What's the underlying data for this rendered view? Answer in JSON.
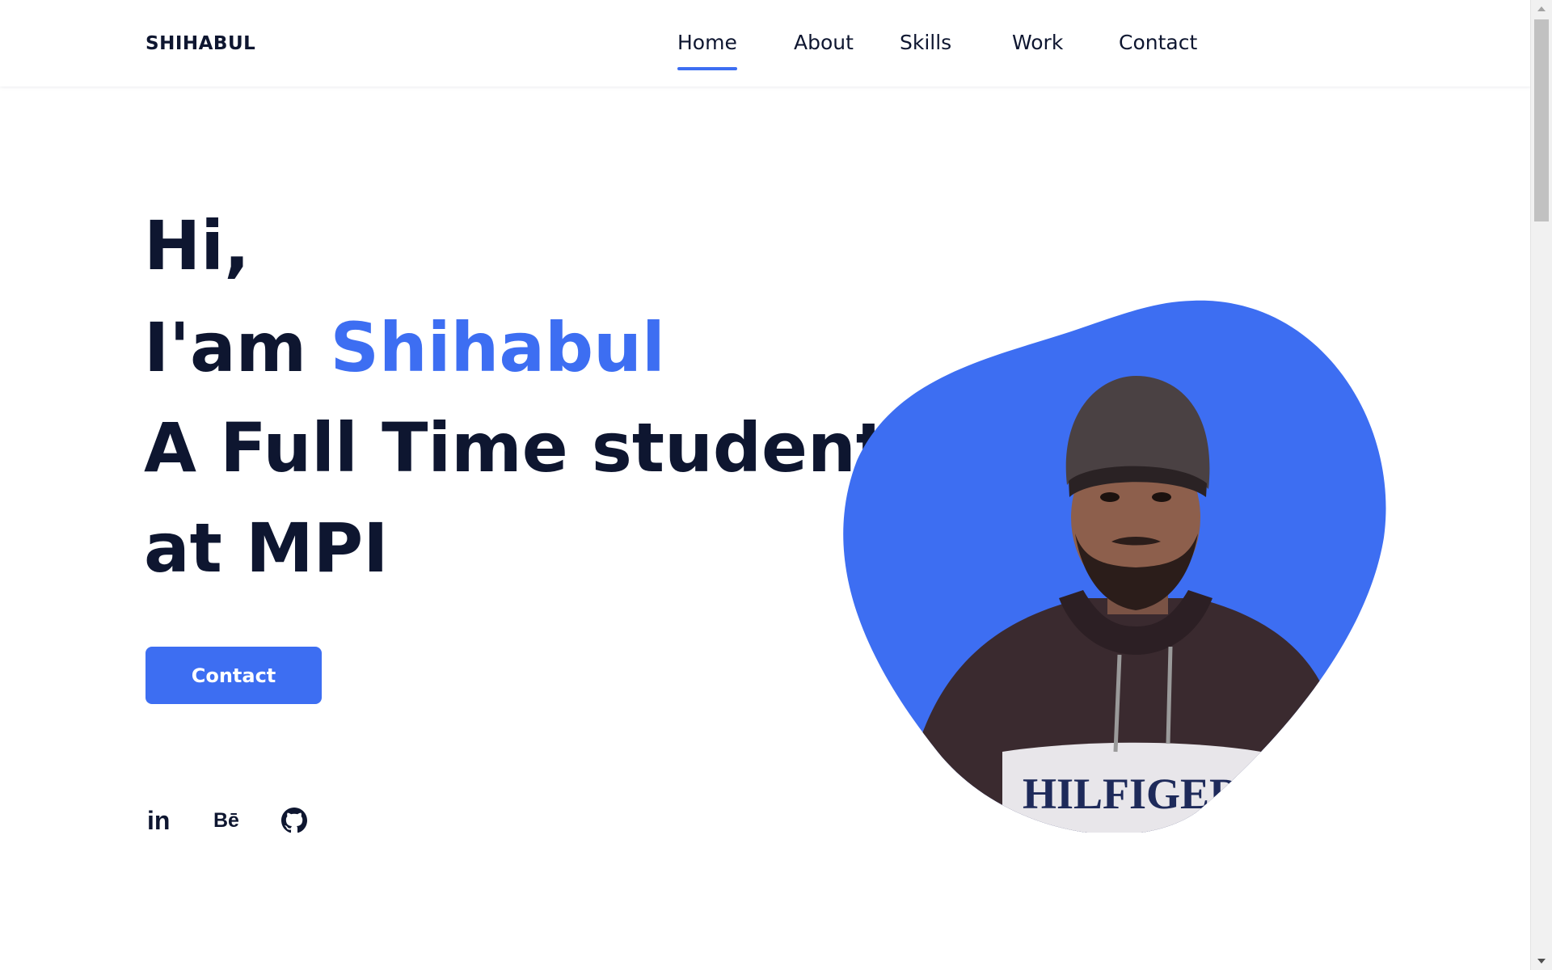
{
  "header": {
    "logo": "SHIHABUL",
    "nav": [
      {
        "label": "Home",
        "active": true
      },
      {
        "label": "About",
        "active": false
      },
      {
        "label": "Skills",
        "active": false
      },
      {
        "label": "Work",
        "active": false
      },
      {
        "label": "Contact",
        "active": false
      }
    ]
  },
  "hero": {
    "greeting": "Hi,",
    "intro_prefix": "I'am ",
    "name": "Shihabul",
    "line3": "A Full Time student",
    "line4": "at MPI",
    "contact_button": "Contact",
    "photo_print_text": "HILFIGER"
  },
  "social": [
    {
      "icon": "linkedin-icon",
      "label": "in"
    },
    {
      "icon": "behance-icon",
      "label": "Bē"
    },
    {
      "icon": "github-icon"
    }
  ],
  "colors": {
    "accent": "#3d6ef2",
    "text": "#0e1630",
    "background": "#ffffff"
  }
}
